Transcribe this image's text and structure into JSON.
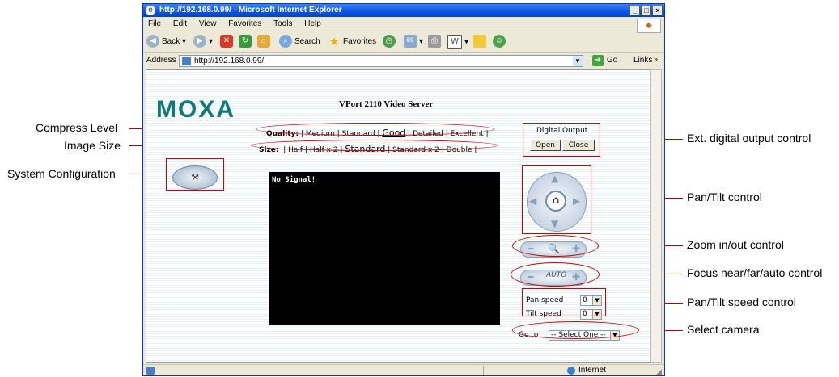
{
  "callouts": {
    "left": [
      "Compress Level",
      "Image Size",
      "System Configuration"
    ],
    "right": [
      "Ext. digital output control",
      "Pan/Tilt control",
      "Zoom in/out control",
      "Focus near/far/auto control",
      "Pan/Tilt speed control",
      "Select camera"
    ]
  },
  "browser": {
    "title": "http://192.168.0.99/ - Microsoft Internet Explorer",
    "menu": [
      "File",
      "Edit",
      "View",
      "Favorites",
      "Tools",
      "Help"
    ],
    "toolbar": {
      "back": "Back",
      "search": "Search",
      "favorites": "Favorites"
    },
    "address_label": "Address",
    "address": "http://192.168.0.99/",
    "go": "Go",
    "links": "Links",
    "status_zone": "Internet"
  },
  "page": {
    "logo": "MOXA",
    "server_title": "VPort 2110 Video Server",
    "quality": {
      "label": "Quality:",
      "options": [
        "Medium",
        "Standard",
        "Good",
        "Detailed",
        "Excellent"
      ],
      "selected": "Good"
    },
    "size": {
      "label": "Size:",
      "options": [
        "Half",
        "Half x 2",
        "Standard",
        "Standard x 2",
        "Double"
      ],
      "selected": "Standard"
    },
    "digital_output": {
      "title": "Digital Output",
      "open": "Open",
      "close": "Close"
    },
    "video_text": "No Signal!",
    "pan_speed": {
      "label": "Pan speed",
      "value": "0"
    },
    "tilt_speed": {
      "label": "Tilt speed",
      "value": "0"
    },
    "goto": {
      "label": "Go to",
      "value": "-- Select One --"
    }
  }
}
